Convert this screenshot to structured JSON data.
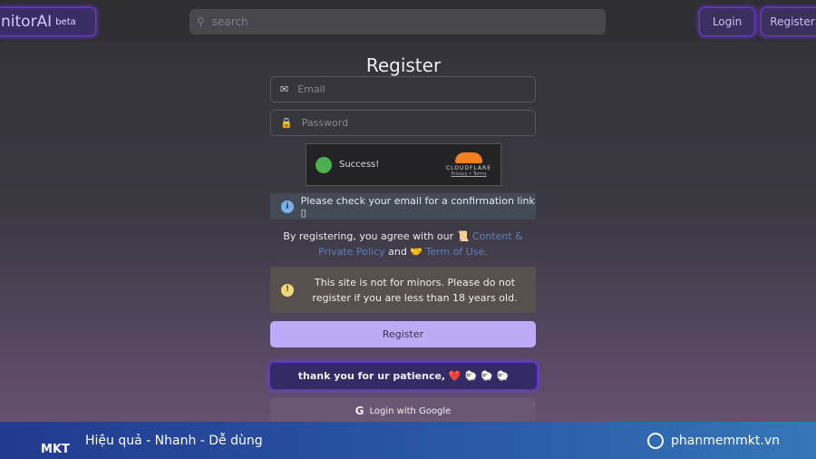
{
  "header": {
    "logo": "nitorAI",
    "logo_badge": "beta",
    "search_placeholder": "search",
    "login": "Login",
    "register": "Register"
  },
  "form": {
    "title": "Register",
    "email_placeholder": "Email",
    "password_placeholder": "Password",
    "captcha": {
      "status": "Success!",
      "brand": "CLOUDFLARE",
      "privacy": "Privacy",
      "terms": "Terms"
    },
    "info": "Please check your email for a confirmation link ▯",
    "agree_prefix": "By registering, you agree with our",
    "policy_link": "Content & Private Policy",
    "and": "and",
    "terms_link": "Term of Use.",
    "warning": "This site is not for minors. Please do not register if you are less than 18 years old.",
    "register_button": "Register",
    "thanks": "thank you for ur patience, ❤️ 🐑 🐑 🐑",
    "google_button": "Login with Google"
  },
  "footer": {
    "brand": "MKT",
    "slogan": "Hiệu quả - Nhanh - Dễ dùng",
    "site": "phanmemmkt.vn"
  },
  "colors": {
    "accent": "#bfaaf5",
    "glow": "#6a3cff",
    "footer": "#2a5aa8"
  }
}
